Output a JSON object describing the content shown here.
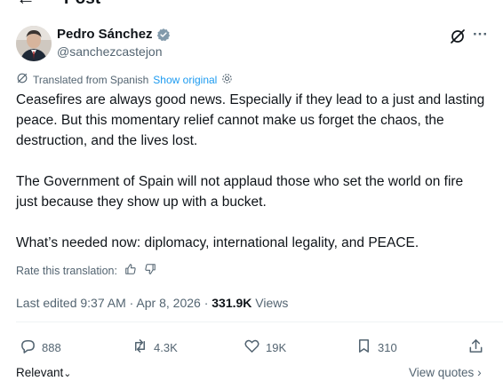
{
  "header": {
    "back_icon": "arrow-left-icon",
    "title": "Post"
  },
  "author": {
    "name": "Pedro Sánchez",
    "handle": "@sanchezcastejon",
    "verified_color": "#829aab"
  },
  "translation": {
    "label": "Translated from Spanish",
    "show_original": "Show original"
  },
  "tweet": {
    "paragraphs": [
      "Ceasefires are always good news. Especially if they lead to a just and lasting peace. But this momentary relief cannot make us forget the chaos, the destruction, and the lives lost.",
      "The Government of Spain will not applaud those who set the world on fire just because they show up with a bucket.",
      "What’s needed now: diplomacy, international legality, and PEACE."
    ]
  },
  "rate": {
    "label": "Rate this translation:"
  },
  "meta": {
    "edited": "Last edited 9:37 AM · Apr 8, 2026 · ",
    "views_count": "331.9K",
    "views_label": "Views"
  },
  "actions": {
    "replies": "888",
    "reposts": "4.3K",
    "likes": "19K",
    "bookmarks": "310"
  },
  "footer": {
    "sort_label": "Relevant",
    "view_quotes": "View quotes"
  },
  "colors": {
    "accent": "#1d9bf0",
    "text": "#0f1419",
    "muted": "#536471"
  }
}
